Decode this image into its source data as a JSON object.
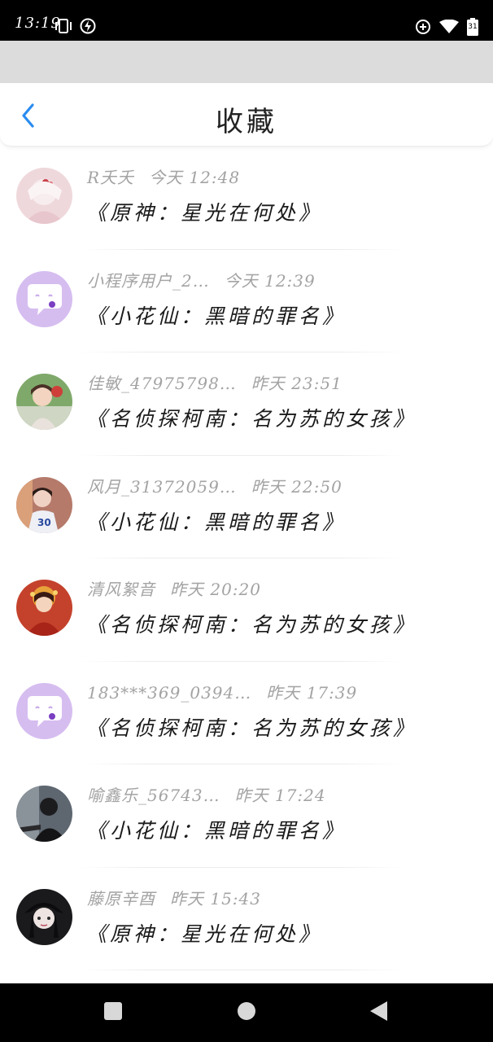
{
  "status_bar": {
    "time": "13:19",
    "left_icons": [
      "vibrate-icon",
      "charging-icon"
    ],
    "right_icons": [
      "data-saver-icon",
      "wifi-icon",
      "battery-icon"
    ],
    "battery_level": "31"
  },
  "header": {
    "title": "收藏",
    "back_icon": "chevron-left-icon",
    "accent_color": "#2a8cf0"
  },
  "favorites": [
    {
      "name": "R夭夭",
      "time": "今天 12:48",
      "title": "《原神：星光在何处》",
      "avatar": "photo-pink-girl"
    },
    {
      "name": "小程序用户_2…",
      "time": "今天 12:39",
      "title": "《小花仙：黑暗的罪名》",
      "avatar": "default-chat-icon"
    },
    {
      "name": "佳敏_47975798…",
      "time": "昨天 23:51",
      "title": "《名侦探柯南：名为苏的女孩》",
      "avatar": "photo-girl-green"
    },
    {
      "name": "风月_31372059…",
      "time": "昨天 22:50",
      "title": "《小花仙：黑暗的罪名》",
      "avatar": "photo-girl-jersey"
    },
    {
      "name": "清风絮音",
      "time": "昨天 20:20",
      "title": "《名侦探柯南：名为苏的女孩》",
      "avatar": "photo-red-costume"
    },
    {
      "name": "183***369_0394…",
      "time": "昨天 17:39",
      "title": "《名侦探柯南：名为苏的女孩》",
      "avatar": "default-chat-icon"
    },
    {
      "name": "喻鑫乐_56743…",
      "time": "昨天 17:24",
      "title": "《小花仙：黑暗的罪名》",
      "avatar": "photo-dark-figure"
    },
    {
      "name": "藤原辛酉",
      "time": "昨天 15:43",
      "title": "《原神：星光在何处》",
      "avatar": "photo-dark-hat"
    }
  ],
  "nav_bar": {
    "buttons": [
      "recents-square-icon",
      "home-circle-icon",
      "back-triangle-icon"
    ]
  }
}
